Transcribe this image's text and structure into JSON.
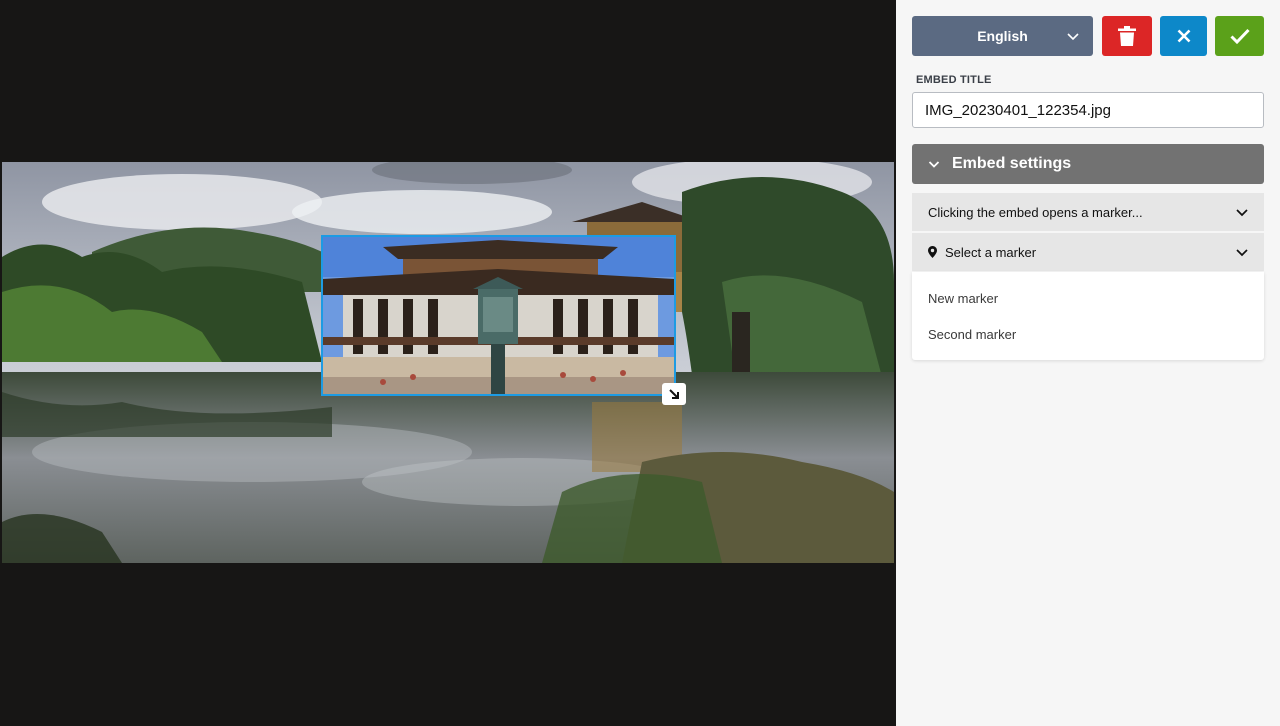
{
  "toolbar": {
    "language": "English",
    "delete_icon": "trash-icon",
    "cancel_icon": "close-icon",
    "confirm_icon": "check-icon",
    "colors": {
      "language": "#5b6a82",
      "delete": "#dc2626",
      "cancel": "#0d88c9",
      "confirm": "#5ba11a"
    }
  },
  "embed_title": {
    "label": "EMBED TITLE",
    "value": "IMG_20230401_122354.jpg"
  },
  "embed_settings": {
    "label": "Embed settings",
    "action_dropdown": "Clicking the embed opens a marker...",
    "marker_dropdown": "Select a marker",
    "marker_options": [
      "New marker",
      "Second marker"
    ]
  },
  "viewer": {
    "selection_color": "#1d9be3"
  }
}
